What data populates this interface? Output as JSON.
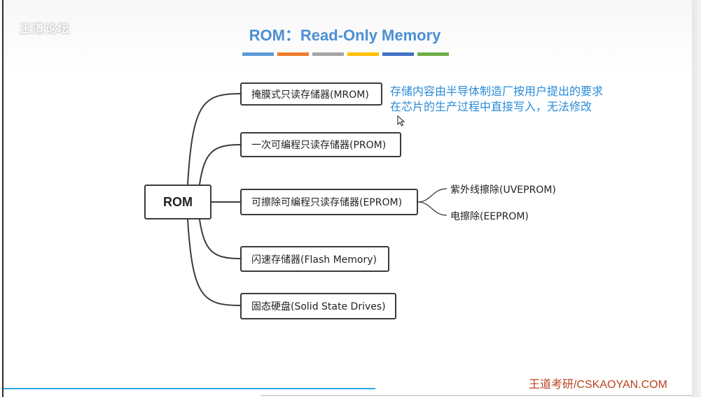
{
  "watermark": "王道论坛",
  "title": "ROM：Read-Only Memory",
  "title_stripes": [
    "#5b9bd5",
    "#ed7d31",
    "#a5a5a5",
    "#ffc000",
    "#4472c4",
    "#70ad47"
  ],
  "mindmap": {
    "root": "ROM",
    "branches": [
      {
        "label": "掩膜式只读存储器(MROM)"
      },
      {
        "label": "一次可编程只读存储器(PROM)"
      },
      {
        "label": "可擦除可编程只读存储器(EPROM)",
        "children": [
          "紫外线擦除(UVEPROM)",
          "电擦除(EEPROM)"
        ]
      },
      {
        "label": "闪速存储器(Flash Memory)"
      },
      {
        "label": "固态硬盘(Solid State Drives)"
      }
    ]
  },
  "annotation": {
    "line1": "存储内容由半导体制造厂按用户提出的要求",
    "line2": "在芯片的生产过程中直接写入，无法修改"
  },
  "footer": "王道考研/CSKAOYAN.COM",
  "playback": {
    "progress": 0.54
  }
}
